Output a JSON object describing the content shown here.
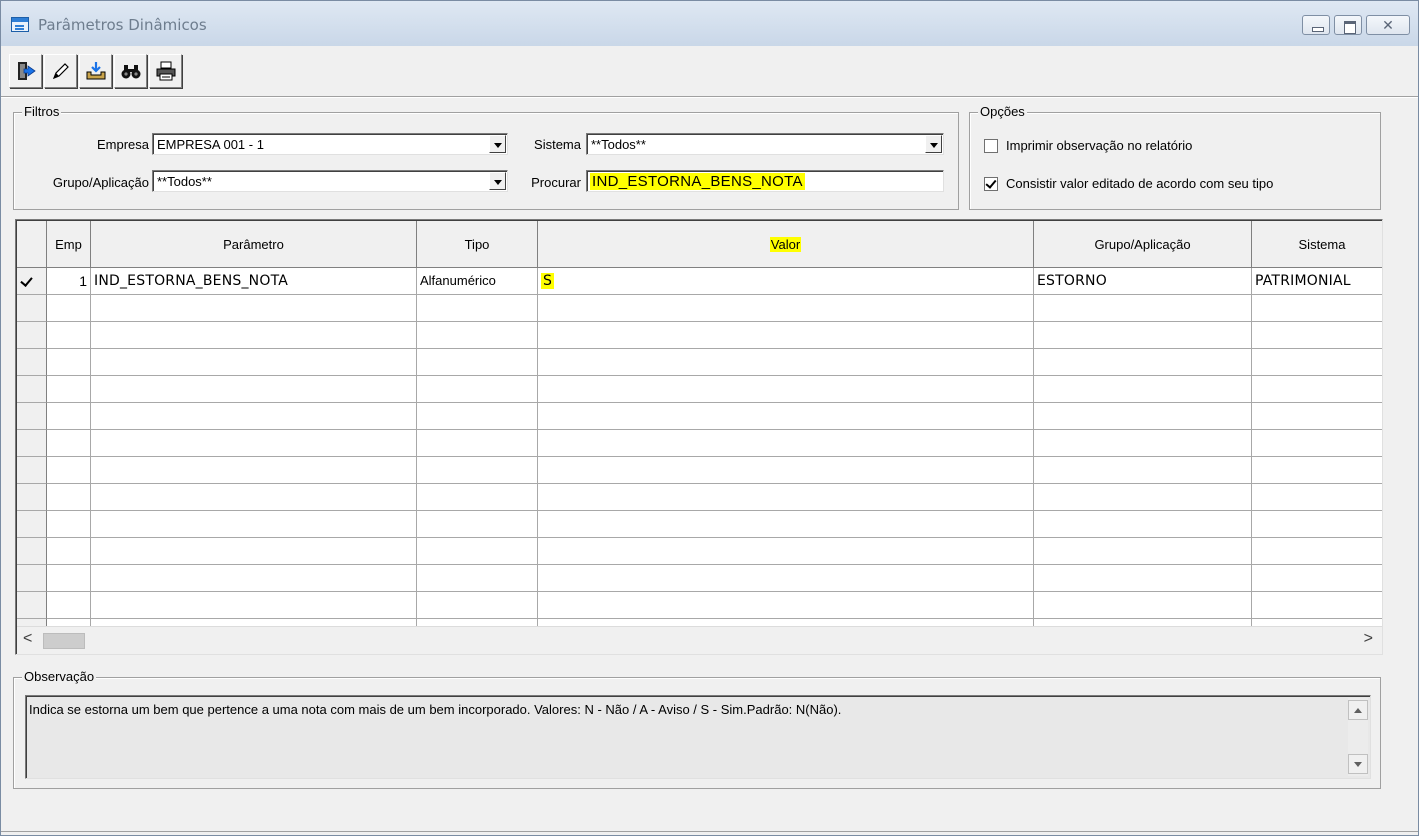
{
  "window": {
    "title": "Parâmetros Dinâmicos",
    "close_glyph": "✕"
  },
  "toolbar": {
    "buttons": [
      {
        "icon": "exit-door-icon"
      },
      {
        "icon": "pencil-icon"
      },
      {
        "icon": "save-tray-icon"
      },
      {
        "icon": "binoculars-icon"
      },
      {
        "icon": "printer-icon"
      }
    ]
  },
  "filtros": {
    "legend": "Filtros",
    "empresa_label": "Empresa",
    "empresa_value": "EMPRESA 001 - 1",
    "sistema_label": "Sistema",
    "sistema_value": "**Todos**",
    "grupo_label": "Grupo/Aplicação",
    "grupo_value": "**Todos**",
    "procurar_label": "Procurar",
    "procurar_value": "IND_ESTORNA_BENS_NOTA"
  },
  "opcoes": {
    "legend": "Opções",
    "opt1_label": "Imprimir observação no relatório",
    "opt1_checked": false,
    "opt2_label": "Consistir valor editado de acordo com seu tipo",
    "opt2_checked": true
  },
  "grid": {
    "headers": {
      "emp": "Emp",
      "parametro": "Parâmetro",
      "tipo": "Tipo",
      "valor": "Valor",
      "grupo": "Grupo/Aplicação",
      "sistema": "Sistema"
    },
    "rows": [
      {
        "emp": "1",
        "parametro": "IND_ESTORNA_BENS_NOTA",
        "tipo": "Alfanumérico",
        "valor": "S",
        "grupo": "ESTORNO",
        "sistema": "PATRIMONIAL"
      }
    ],
    "scroll_left": "<",
    "scroll_right": ">"
  },
  "observacao": {
    "legend": "Observação",
    "text": "Indica se estorna um bem que pertence a uma nota com mais de um bem incorporado. Valores: N - Não / A - Aviso / S - Sim.Padrão: N(Não)."
  },
  "colors": {
    "highlight": "#ffff00",
    "title_bar": "#c9d7e8",
    "window_bg": "#f0f0f0"
  }
}
